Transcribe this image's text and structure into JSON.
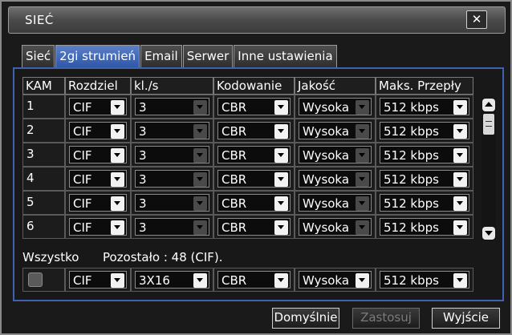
{
  "window": {
    "title": "SIEĆ",
    "close_label": "✕"
  },
  "tabs": [
    {
      "label": "Sieć",
      "active": false
    },
    {
      "label": "2gi strumień",
      "active": true
    },
    {
      "label": "Email",
      "active": false
    },
    {
      "label": "Serwer",
      "active": false
    },
    {
      "label": "Inne ustawienia",
      "active": false
    }
  ],
  "table": {
    "columns": [
      "KAM",
      "Rozdziel",
      "kl./s",
      "Kodowanie",
      "Jakość",
      "Maks. Przepły"
    ],
    "rows": [
      {
        "cam": "1",
        "resolution": "CIF",
        "fps": "3",
        "encoding": "CBR",
        "quality": "Wysoka",
        "bitrate": "512 kbps"
      },
      {
        "cam": "2",
        "resolution": "CIF",
        "fps": "3",
        "encoding": "CBR",
        "quality": "Wysoka",
        "bitrate": "512 kbps"
      },
      {
        "cam": "3",
        "resolution": "CIF",
        "fps": "3",
        "encoding": "CBR",
        "quality": "Wysoka",
        "bitrate": "512 kbps"
      },
      {
        "cam": "4",
        "resolution": "CIF",
        "fps": "3",
        "encoding": "CBR",
        "quality": "Wysoka",
        "bitrate": "512 kbps"
      },
      {
        "cam": "5",
        "resolution": "CIF",
        "fps": "3",
        "encoding": "CBR",
        "quality": "Wysoka",
        "bitrate": "512 kbps"
      },
      {
        "cam": "6",
        "resolution": "CIF",
        "fps": "3",
        "encoding": "CBR",
        "quality": "Wysoka",
        "bitrate": "512 kbps"
      }
    ]
  },
  "all": {
    "label": "Wszystko",
    "remaining": "Pozostało : 48 (CIF).",
    "resolution": "CIF",
    "fps": "3X16",
    "encoding": "CBR",
    "quality": "Wysoka",
    "bitrate": "512 kbps"
  },
  "buttons": {
    "default": "Domyślnie",
    "apply": "Zastosuj",
    "exit": "Wyjście"
  },
  "colors": {
    "active_tab": "#2f57a8",
    "panel_border": "#3f62b0"
  }
}
